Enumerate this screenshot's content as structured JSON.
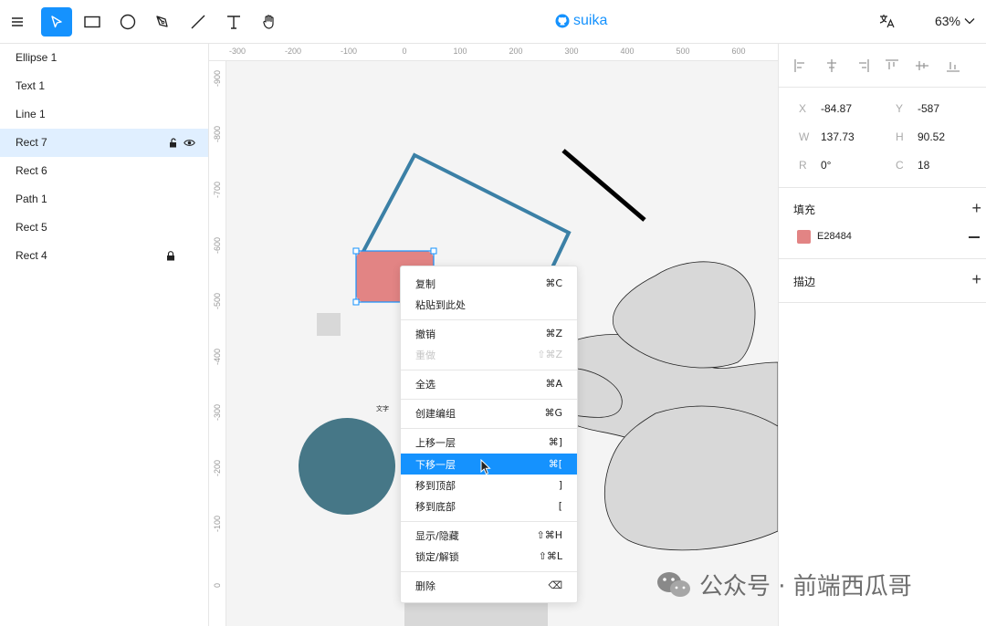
{
  "toolbar": {
    "tools": [
      "menu-icon",
      "select-icon",
      "rect-tool-icon",
      "ellipse-tool-icon",
      "pen-tool-icon",
      "line-tool-icon",
      "text-tool-icon",
      "hand-tool-icon"
    ],
    "brand": "suika",
    "zoom": "63%"
  },
  "layers": [
    {
      "label": "Ellipse 1"
    },
    {
      "label": "Text 1"
    },
    {
      "label": "Line 1"
    },
    {
      "label": "Rect 7"
    },
    {
      "label": "Rect 6"
    },
    {
      "label": "Path 1"
    },
    {
      "label": "Rect 5"
    },
    {
      "label": "Rect 4"
    }
  ],
  "ruler_top": [
    "-300",
    "-200",
    "-100",
    "0",
    "100",
    "200",
    "300",
    "400",
    "500",
    "600"
  ],
  "ruler_left": [
    "-900",
    "-800",
    "-700",
    "-600",
    "-500",
    "-400",
    "-300",
    "-200",
    "-100",
    "0"
  ],
  "canvas": {
    "text_label": "文字",
    "colors": {
      "rect_fill": "#E28484",
      "ellipse_fill": "#467787",
      "polygon_stroke": "#3b80a6",
      "selection": "#1592fe"
    }
  },
  "context_menu": [
    {
      "label": "复制",
      "shortcut": "⌘C"
    },
    {
      "label": "粘贴到此处",
      "shortcut": ""
    },
    {
      "label": "撤销",
      "shortcut": "⌘Z"
    },
    {
      "label": "重做",
      "shortcut": "⇧⌘Z"
    },
    {
      "label": "全选",
      "shortcut": "⌘A"
    },
    {
      "label": "创建编组",
      "shortcut": "⌘G"
    },
    {
      "label": "上移一层",
      "shortcut": "⌘]"
    },
    {
      "label": "下移一层",
      "shortcut": "⌘["
    },
    {
      "label": "移到顶部",
      "shortcut": "]"
    },
    {
      "label": "移到底部",
      "shortcut": "["
    },
    {
      "label": "显示/隐藏",
      "shortcut": "⇧⌘H"
    },
    {
      "label": "锁定/解锁",
      "shortcut": "⇧⌘L"
    },
    {
      "label": "删除",
      "shortcut": "⌫"
    }
  ],
  "props": {
    "x_label": "X",
    "x": "-84.87",
    "y_label": "Y",
    "y": "-587",
    "w_label": "W",
    "w": "137.73",
    "h_label": "H",
    "h": "90.52",
    "r_label": "R",
    "r": "0°",
    "c_label": "C",
    "c": "18",
    "fill_title": "填充",
    "fill_hex": "E28484",
    "stroke_title": "描边"
  },
  "watermark": "公众号 · 前端西瓜哥"
}
